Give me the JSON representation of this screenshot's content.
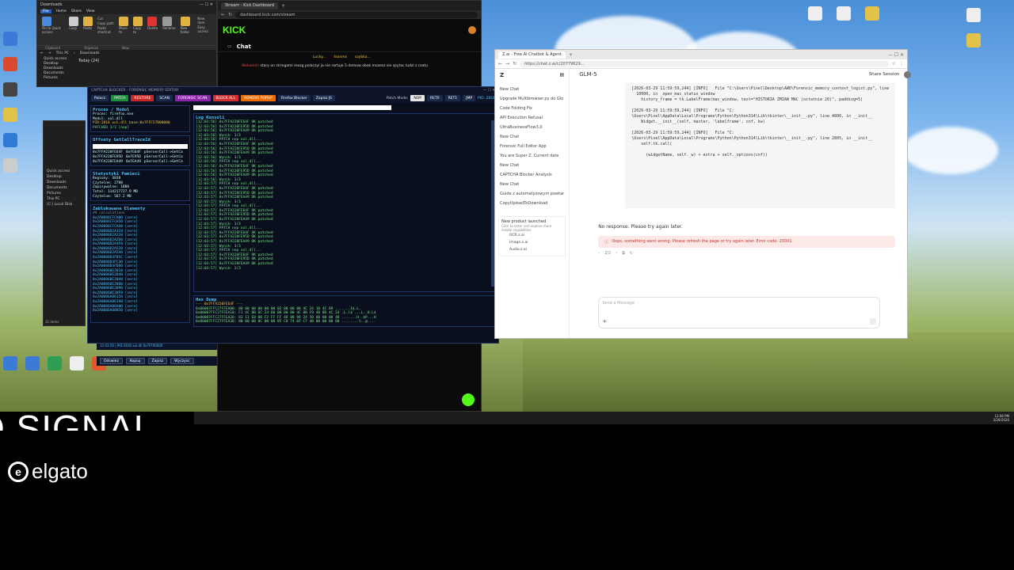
{
  "explorer": {
    "title": "Downloads",
    "tabs": [
      "File",
      "Home",
      "Share",
      "View"
    ],
    "ribbon_buttons": [
      "Pin to Quick access",
      "Copy",
      "Paste",
      "Cut",
      "Copy path",
      "Paste shortcut",
      "Move to",
      "Copy to",
      "Delete",
      "Rename",
      "New folder",
      "New item",
      "Easy access"
    ],
    "groups": [
      "Clipboard",
      "Organize",
      "New"
    ],
    "path": [
      "This PC",
      "Downloads"
    ],
    "nav_items": [
      "Quick access",
      "Desktop",
      "Downloads",
      "Documents",
      "Pictures",
      "This PC",
      "(C:) Local Disk"
    ],
    "list_header": "Today (24)",
    "status": "31 items"
  },
  "kick": {
    "tab_title": "Stream - Kick Dashboard",
    "url": "dashboard.kick.com/stream",
    "logo": "KICK",
    "chat_title": "Chat",
    "chat_users": [
      "Lucky...",
      "tsonms",
      "szybka..."
    ],
    "chat_message_user": "Wolvenhl",
    "chat_message": "stary on stringami mozg polaczyl ja nie rartuje 5 domow obok mozesz sie spytac ludzi z czatu"
  },
  "forensic": {
    "title": "CAPTCHA BLOCKER - FORENSIC MEMORY EDITOR",
    "toolbar": [
      {
        "label": "Polacz",
        "color": "#1b2a4a"
      },
      {
        "label": "PATCH",
        "color": "#1e8e3e"
      },
      {
        "label": "RESTORE",
        "color": "#c62828"
      },
      {
        "label": "SCAN",
        "color": "#1b2a4a"
      },
      {
        "label": "FORENSIC SCAN",
        "color": "#8e24aa"
      },
      {
        "label": "BLOCK ALL",
        "color": "#d32f2f"
      },
      {
        "label": "REMOVE POPUP",
        "color": "#ef6c00"
      },
      {
        "label": "Firefox Blocker",
        "color": "#1b2a4a"
      },
      {
        "label": "Zapisz JS",
        "color": "#1b2a4a"
      }
    ],
    "patch_mode_label": "Patch Mode:",
    "patch_modes": [
      "NOP",
      "RET0",
      "RET1",
      "JMP"
    ],
    "pid_label": "PID: 2816",
    "process_title": "Proces / Modul",
    "process_lines": [
      "Proces: firefox.exe",
      "Modul: xul.dll",
      "PID:2816 xul.dll base:0x7FFC57B00000",
      "PATCHED 3/3 [nop]"
    ],
    "offsets_title": "Offsety GetCallTraceId",
    "offsets": [
      [
        "0x7FFA220FE64F",
        "0xFE64F",
        "pServerCall->GetCa"
      ],
      [
        "0x7FFA220FE95D",
        "0xFE95D",
        "pServerCall->GetCa"
      ],
      [
        "0x7FFA220FEA49",
        "0xFEA49",
        "pServerCall->GetCa"
      ]
    ],
    "stats_title": "Statystyki Pamieci",
    "stats": [
      "Regiony: 4838",
      "Czytelne: 2780",
      "Zapisywalne: 1806",
      "Total: 114217727.9 MB",
      "Czytelne: 567.2 MB"
    ],
    "blocked_title": "Zablokowane Elementy",
    "blocked_subtitle": "## calculations",
    "blocked_items": [
      "0x2A0086CFCA00 [zero]",
      "0x2A0086CFCA50 [zero]",
      "0x2A0086CFCAA0 [zero]",
      "0x2A0086D2A1C0 [zero]",
      "0x2A0086D2A210 [zero]",
      "0x2A0086D2A2D0 [zero]",
      "0x2A0086D2A4F0 [zero]",
      "0x2A0086D2A520 [zero]",
      "0x2A0086D2A5A0 [zero]",
      "0x2A0086D4FB5C [zero]",
      "0x2A0086D4FC30 [zero]",
      "0x2A0086D4FD80 [zero]",
      "0x2A00860E2010 [zero]",
      "0x2A00860E2040 [zero]",
      "0x2A00860E20A0 [zero]",
      "0x2A00860E2080 [zero]",
      "0x2A00860E2090 [zero]",
      "0x2A00860E20F0 [zero]",
      "0x2A0086A06150 [zero]",
      "0x2A0086A06190 [zero]",
      "0x2A0086A06A00 [zero]",
      "0x2A0086A08850 [zero]"
    ],
    "log_title": "Log Konsoli",
    "log_lines": [
      "[12:03:56] 0x7FFA220FE64F OK patched",
      "[12:03:56] 0x7FFA220FE95D OK patched",
      "[12:03:56] 0x7FFA220FEA49 OK patched",
      "[12:03:56] Wynik: 3/3",
      "[12:03:56] PATCH nop xul.dll...",
      "[12:03:56] 0x7FFA220FE64F OK patched",
      "[12:03:56] 0x7FFA220FE95D OK patched",
      "[12:03:56] 0x7FFA220FEA49 OK patched",
      "[12:03:56] Wynik: 3/3",
      "[12:03:56] PATCH nop xul.dll...",
      "[12:03:56] 0x7FFA220FE64F OK patched",
      "[12:03:56] 0x7FFA220FE95D OK patched",
      "[12:03:56] 0x7FFA220FEA49 OK patched",
      "[12:03:56] Wynik: 3/3",
      "[12:03:57] PATCH nop xul.dll...",
      "[12:03:57] 0x7FFA220FE64F OK patched",
      "[12:03:57] 0x7FFA220FE95D OK patched",
      "[12:03:57] 0x7FFA220FEA49 OK patched",
      "[12:03:57] Wynik: 3/3",
      "[12:03:57] PATCH nop xul.dll...",
      "[12:03:57] 0x7FFA220FE64F OK patched",
      "[12:03:57] 0x7FFA220FE95D OK patched",
      "[12:03:57] 0x7FFA220FEA49 OK patched",
      "[12:03:57] Wynik: 3/3",
      "[12:03:57] PATCH nop xul.dll...",
      "[12:03:57] 0x7FFA220FE64F OK patched",
      "[12:03:57] 0x7FFA220FE95D OK patched",
      "[12:03:57] 0x7FFA220FEA49 OK patched",
      "[12:03:57] Wynik: 3/3",
      "[12:03:57] PATCH nop xul.dll...",
      "[12:03:57] 0x7FFA220FE64F OK patched",
      "[12:03:57] 0x7FFA220FE95D OK patched",
      "[12:03:57] 0x7FFA220FEA49 OK patched",
      "[12:03:57] Wynik: 3/3"
    ],
    "hex_title": "Hex Dump",
    "hex_lines": [
      "--- 0x7FFA220FE64F ---",
      "0x00007FFC27FFEA00: 00 00 00 00 00 00 02 00 00 00 4C 24 10 4C 89 .......1$.L.",
      "0x00007FFC27FFEA10: F1 4C 8B 6C 24 60 00 00 00 4C 8B F9 48 8D 4C 24 .L.l$`...L..H.L$",
      "0x00007FFC27FFEA20: 83 11 E0 00 F2 FF FF 48 8B 94 24 50 00 00 00 48 .......H..$P...H",
      "0x00007FFC27FFEA30: 8B 00 00 0C 00 00 85 C0 74 07 C7 40 00 00 00 00 ........t..@...."
    ],
    "footer_status": "12:03:56  |  PID 2816 xul.dll 0x7FF00000",
    "footer_buttons": [
      "Odswiez",
      "Kopiuj",
      "Zapisz",
      "Wyczysc"
    ]
  },
  "zai": {
    "tab_title": "Z.ai - Free AI Chatbot & Agent",
    "url": "https://chat.z.ai/c/20779629...",
    "model": "GLM-5",
    "share_button": "Share Session",
    "new_chat": "New Chat",
    "history": [
      "Upgrade Multibrowser.py do Glo",
      "Code Folding Fix",
      "API Execution Refusal",
      "UltraBusinessFlow3.0",
      "New Chat",
      "Forensic Full Editor App",
      "You are Super Z. Current date",
      "New Chat",
      "CAPTCHA Blocker Analysis",
      "New Chat",
      "Guide z automatyzowym powtar",
      "CopyUploadToDownload"
    ],
    "promo_title": "New product launched",
    "promo_text": "Click to enter and explore more mobile capabilities",
    "promo_links": [
      "OCR.z.ai",
      "Image.z.ai",
      "Audio.z.ai"
    ],
    "code_lines": [
      "[2026-03-29 11:59:59,244] [INFO]   File \"C:\\Users\\Pixel\\Desktop\\AWD\\Forensic_memory_context_logist.py\", line",
      "  10000, in _open_mac_status_window",
      "    history_frame = tk.LabelFrame(mac_window, text=\"HISTORIA ZMIAN MAC (ostatnie 20)\", padding=5)",
      "",
      "[2026-03-29 11:59:59,244] [INFO]   File \"C:",
      "\\Users\\Pixel\\AppData\\Local\\Programs\\Python\\Python314\\Lib\\tkinter\\__init__.py\", line 4800, in __init__",
      "    Widget.__init__(self, master, 'labelframe', cnf, kw)",
      "",
      "[2026-03-29 11:59:59,244] [INFO]   File \"C:",
      "\\Users\\Pixel\\AppData\\Local\\Programs\\Python\\Python314\\Lib\\tkinter\\__init__.py\", line 2805, in __init__",
      "    self.tk.call(",
      "",
      "      (widgetName, self._w) + extra + self._options(cnf))"
    ],
    "no_response": "No response. Please try again later.",
    "error_text": "Oops, something went wrong. Please refresh the page or try again later. Error code: 20001",
    "pager": "2/2",
    "input_placeholder": "Send a Message"
  },
  "overlay": {
    "signal_text": "O SIGNAL",
    "brand": "elgato"
  },
  "taskbar": {
    "time": "12:08 PM",
    "date": "3/29/2026"
  }
}
